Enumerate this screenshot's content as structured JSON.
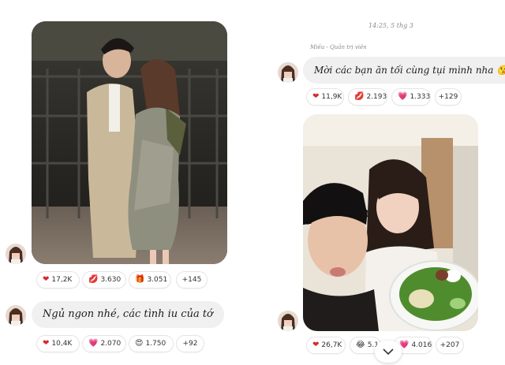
{
  "timestamp": "14:25, 5 thg 3",
  "sender_label": "Miều - Quản trị viên",
  "messages": {
    "left_photo_reactions": [
      {
        "icon": "heart-icon",
        "count": "17,2K"
      },
      {
        "icon": "kiss-fire-icon",
        "count": "3.630"
      },
      {
        "icon": "gift-icon",
        "count": "3.051"
      },
      {
        "icon": "",
        "count": "+145"
      }
    ],
    "left_text": "Ngủ ngon nhé, các tình iu của tớ",
    "left_text_reactions": [
      {
        "icon": "heart-icon",
        "count": "10,4K"
      },
      {
        "icon": "heart-face-icon",
        "count": "2.070"
      },
      {
        "icon": "love-face-icon",
        "count": "1.750"
      },
      {
        "icon": "",
        "count": "+92"
      }
    ],
    "right_text": "Mời các bạn ăn tối cùng tụi mình nha 😘",
    "right_text_reactions": [
      {
        "icon": "heart-icon",
        "count": "11,9K"
      },
      {
        "icon": "kiss-icon",
        "count": "2.193"
      },
      {
        "icon": "heart-face-icon",
        "count": "1.333"
      },
      {
        "icon": "",
        "count": "+129"
      }
    ],
    "right_photo_reactions": [
      {
        "icon": "heart-icon",
        "count": "26,7K"
      },
      {
        "icon": "laugh-icon",
        "count": "5.1"
      },
      {
        "icon": "heart-face-icon",
        "count": "4.016"
      },
      {
        "icon": "",
        "count": "+207"
      }
    ]
  },
  "colors": {
    "heart": "#d62a2e",
    "bubble": "#f0f0f0"
  }
}
